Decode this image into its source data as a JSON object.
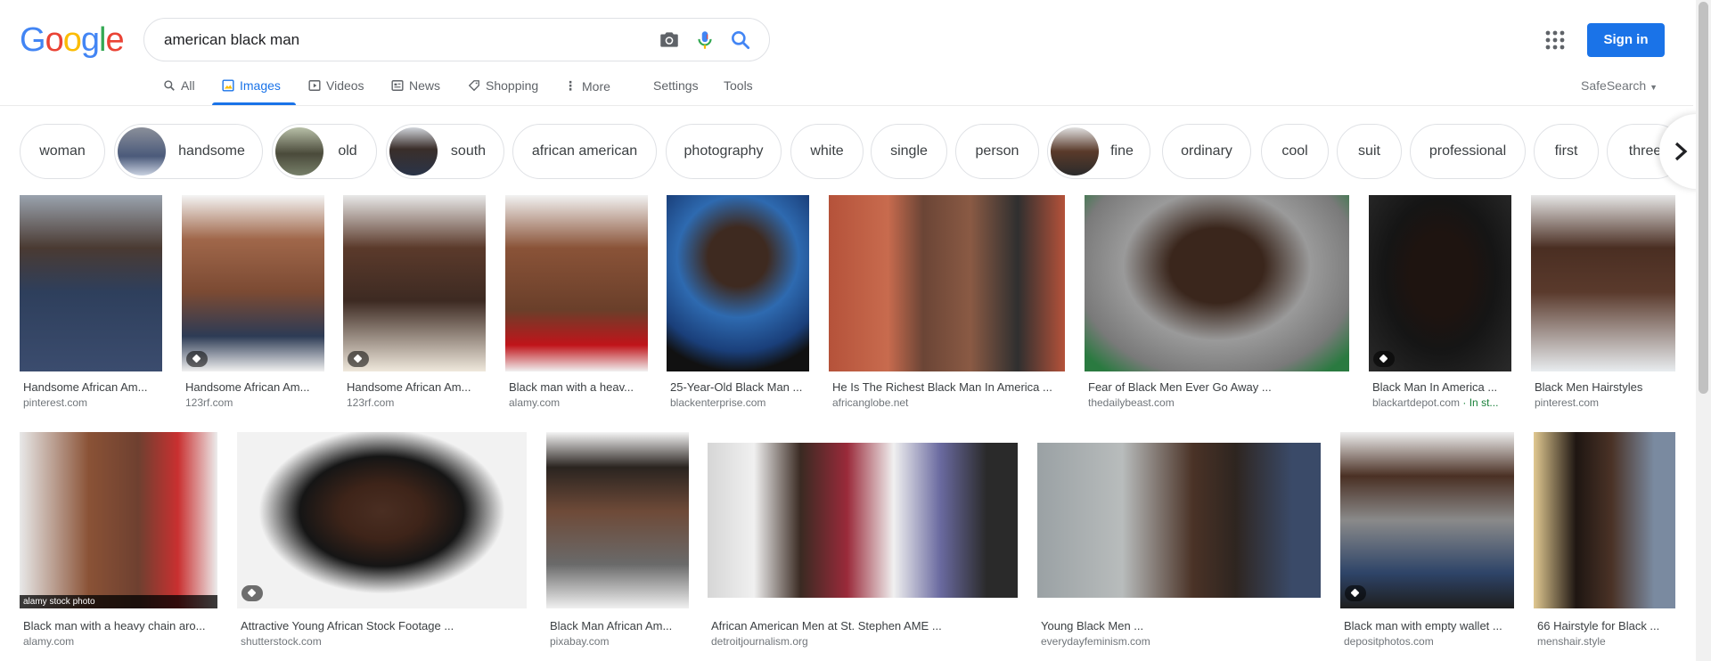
{
  "header": {
    "logo_text": "Google",
    "query": "american black man",
    "sign_in_label": "Sign in"
  },
  "nav": {
    "all": "All",
    "images": "Images",
    "videos": "Videos",
    "news": "News",
    "shopping": "Shopping",
    "more": "More",
    "settings": "Settings",
    "tools": "Tools",
    "safesearch": "SafeSearch"
  },
  "chips": [
    {
      "label": "woman"
    },
    {
      "label": "handsome"
    },
    {
      "label": "old"
    },
    {
      "label": "south"
    },
    {
      "label": "african american"
    },
    {
      "label": "photography"
    },
    {
      "label": "white"
    },
    {
      "label": "single"
    },
    {
      "label": "person"
    },
    {
      "label": "fine"
    },
    {
      "label": "ordinary"
    },
    {
      "label": "cool"
    },
    {
      "label": "suit"
    },
    {
      "label": "professional"
    },
    {
      "label": "first"
    },
    {
      "label": "three"
    }
  ],
  "results_row1": [
    {
      "caption": "Handsome African Am...",
      "source": "pinterest.com"
    },
    {
      "caption": "Handsome African Am...",
      "source": "123rf.com"
    },
    {
      "caption": "Handsome African Am...",
      "source": "123rf.com"
    },
    {
      "caption": "Black man with a heav...",
      "source": "alamy.com"
    },
    {
      "caption": "25-Year-Old Black Man ...",
      "source": "blackenterprise.com"
    },
    {
      "caption": "He Is The Richest Black Man In America ...",
      "source": "africanglobe.net"
    },
    {
      "caption": "Fear of Black Men Ever Go Away ...",
      "source": "thedailybeast.com"
    },
    {
      "caption": "Black Man In America ...",
      "source": "blackartdepot.com",
      "extra": " · In st..."
    },
    {
      "caption": "Black Men Hairstyles",
      "source": "pinterest.com"
    }
  ],
  "results_row2": [
    {
      "caption": "Black man with a heavy chain aro...",
      "source": "alamy.com",
      "watermark": "alamy stock photo"
    },
    {
      "caption": "Attractive Young African Stock Footage ...",
      "source": "shutterstock.com"
    },
    {
      "caption": "Black Man African Am...",
      "source": "pixabay.com"
    },
    {
      "caption": "African American Men at St. Stephen AME ...",
      "source": "detroitjournalism.org"
    },
    {
      "caption": "Young Black Men ...",
      "source": "everydayfeminism.com"
    },
    {
      "caption": "Black man with empty wallet ...",
      "source": "depositphotos.com"
    },
    {
      "caption": "66 Hairstyle for Black ...",
      "source": "menshair.style"
    }
  ]
}
